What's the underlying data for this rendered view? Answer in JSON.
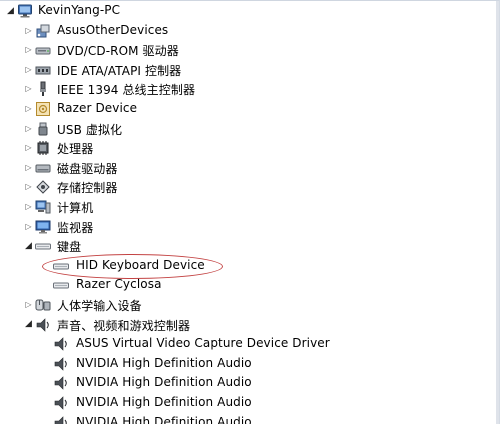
{
  "root": {
    "label": "KevinYang-PC",
    "icon": "computer-root-icon",
    "toggle": "expanded"
  },
  "items": [
    {
      "label": "AsusOtherDevices",
      "icon": "device-cluster-icon",
      "toggle": "collapsed"
    },
    {
      "label": "DVD/CD-ROM 驱动器",
      "icon": "optical-drive-icon",
      "toggle": "collapsed"
    },
    {
      "label": "IDE ATA/ATAPI 控制器",
      "icon": "ide-controller-icon",
      "toggle": "collapsed"
    },
    {
      "label": "IEEE 1394 总线主控制器",
      "icon": "ieee1394-icon",
      "toggle": "collapsed"
    },
    {
      "label": "Razer Device",
      "icon": "razer-device-icon",
      "toggle": "collapsed"
    },
    {
      "label": "USB 虚拟化",
      "icon": "usb-icon",
      "toggle": "collapsed"
    },
    {
      "label": "处理器",
      "icon": "processor-icon",
      "toggle": "collapsed"
    },
    {
      "label": "磁盘驱动器",
      "icon": "disk-drive-icon",
      "toggle": "collapsed"
    },
    {
      "label": "存储控制器",
      "icon": "storage-controller-icon",
      "toggle": "collapsed"
    },
    {
      "label": "计算机",
      "icon": "computer-icon",
      "toggle": "collapsed"
    },
    {
      "label": "监视器",
      "icon": "monitor-icon",
      "toggle": "collapsed"
    },
    {
      "label": "键盘",
      "icon": "keyboard-icon",
      "toggle": "expanded",
      "children": [
        {
          "label": "HID Keyboard Device",
          "icon": "keyboard-icon",
          "circled": true
        },
        {
          "label": "Razer Cyclosa",
          "icon": "keyboard-icon"
        }
      ]
    },
    {
      "label": "人体学输入设备",
      "icon": "hid-input-icon",
      "toggle": "collapsed"
    },
    {
      "label": "声音、视频和游戏控制器",
      "icon": "speaker-icon",
      "toggle": "expanded",
      "children": [
        {
          "label": "ASUS Virtual Video Capture Device Driver",
          "icon": "speaker-icon"
        },
        {
          "label": "NVIDIA High Definition Audio",
          "icon": "speaker-icon"
        },
        {
          "label": "NVIDIA High Definition Audio",
          "icon": "speaker-icon"
        },
        {
          "label": "NVIDIA High Definition Audio",
          "icon": "speaker-icon"
        },
        {
          "label": "NVIDIA High Definition Audio",
          "icon": "speaker-icon"
        }
      ]
    }
  ],
  "colors": {
    "annotation": "#c34343",
    "toggle": "#5b5b5b"
  }
}
